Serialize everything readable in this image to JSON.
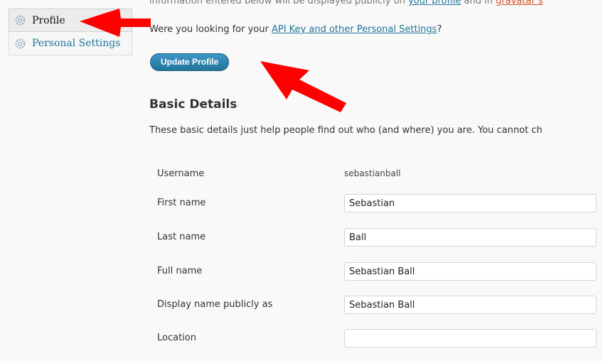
{
  "sidebar": {
    "items": [
      {
        "label": "Profile",
        "icon": "gear-icon"
      },
      {
        "label": "Personal Settings",
        "icon": "gear-icon"
      }
    ]
  },
  "intro": {
    "cut_line_before": "information entered below will be displayed publicly on",
    "cut_link1": "your profile",
    "cut_middle": "and in",
    "cut_link2": "gravatar s",
    "api_prefix": "Were you looking for your",
    "api_link": "API Key and other Personal Settings",
    "api_suffix": "?"
  },
  "update_button": "Update Profile",
  "basic": {
    "title": "Basic Details",
    "description": "These basic details just help people find out who (and where) you are. You cannot ch"
  },
  "fields": {
    "username": {
      "label": "Username",
      "value": "sebastianball"
    },
    "first_name": {
      "label": "First name",
      "value": "Sebastian"
    },
    "last_name": {
      "label": "Last name",
      "value": "Ball"
    },
    "full_name": {
      "label": "Full name",
      "value": "Sebastian Ball"
    },
    "display_name": {
      "label": "Display name publicly as",
      "value": "Sebastian Ball"
    },
    "location": {
      "label": "Location",
      "value": ""
    }
  },
  "colors": {
    "accent": "#21759b",
    "arrow": "#ff0000"
  }
}
